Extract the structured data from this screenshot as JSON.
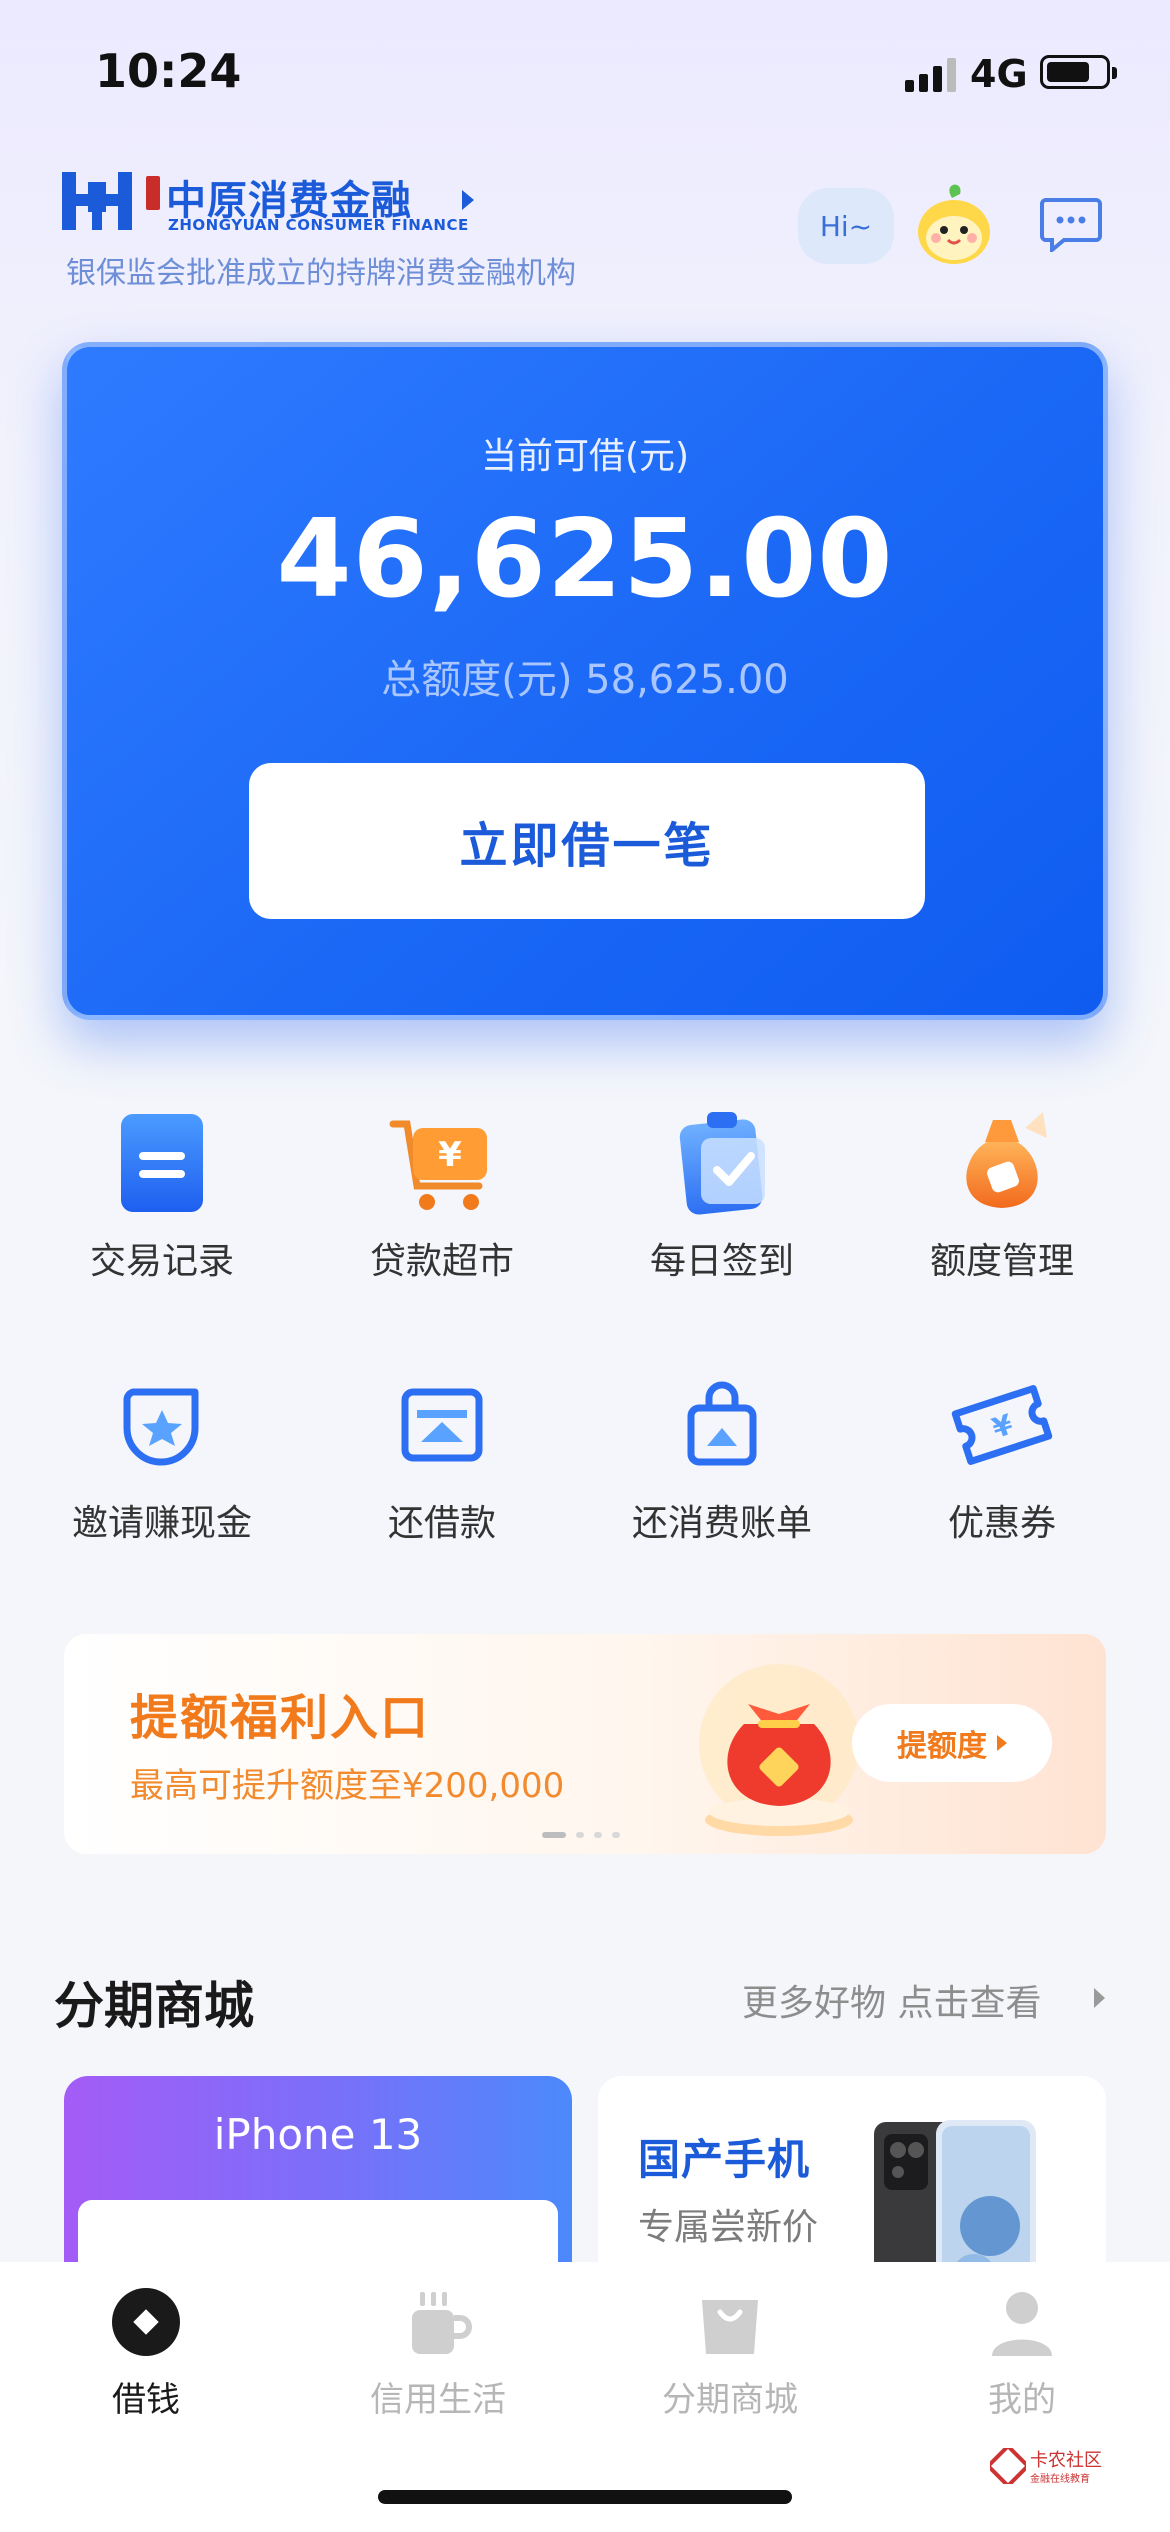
{
  "status_bar": {
    "time": "10:24",
    "network": "4G"
  },
  "header": {
    "brand_name": "中原消费金融",
    "brand_sub": "ZHONGYUAN CONSUMER FINANCE",
    "tagline": "银保监会批准成立的持牌消费金融机构",
    "hi_label": "Hi~"
  },
  "credit_card": {
    "available_label": "当前可借(元)",
    "available_amount": "46,625.00",
    "total_label": "总额度(元) 58,625.00",
    "borrow_button": "立即借一笔"
  },
  "grid": [
    {
      "label": "交易记录",
      "icon": "document-icon"
    },
    {
      "label": "贷款超市",
      "icon": "cart-yuan-icon"
    },
    {
      "label": "每日签到",
      "icon": "checklist-icon"
    },
    {
      "label": "额度管理",
      "icon": "money-bag-icon"
    },
    {
      "label": "邀请赚现金",
      "icon": "star-badge-icon"
    },
    {
      "label": "还借款",
      "icon": "repay-icon"
    },
    {
      "label": "还消费账单",
      "icon": "shopping-bag-icon"
    },
    {
      "label": "优惠券",
      "icon": "coupon-icon"
    }
  ],
  "banner": {
    "title": "提额福利入口",
    "subtitle": "最高可提升额度至¥200,000",
    "button": "提额度"
  },
  "mall": {
    "title": "分期商城",
    "more": "更多好物 点击查看",
    "left_card_title": "iPhone 13",
    "right_card_title": "国产手机",
    "right_card_subtitle": "专属尝新价"
  },
  "tabbar": [
    {
      "label": "借钱",
      "icon": "diamond-coin-icon",
      "active": true
    },
    {
      "label": "信用生活",
      "icon": "coffee-cup-icon",
      "active": false
    },
    {
      "label": "分期商城",
      "icon": "shopping-bag-icon",
      "active": false
    },
    {
      "label": "我的",
      "icon": "user-icon",
      "active": false
    }
  ],
  "watermark": {
    "label": "卡农社区",
    "sub": "金融在线教育"
  },
  "colors": {
    "primary": "#1b5bd9",
    "card_blue": "#1b68f6",
    "orange": "#f07a1c"
  }
}
